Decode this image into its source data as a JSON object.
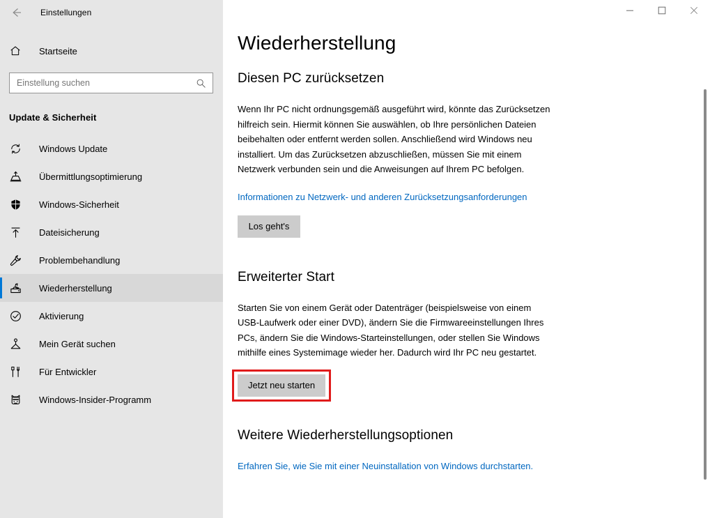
{
  "window": {
    "title": "Einstellungen",
    "back_icon": "back-arrow-icon",
    "minimize_label": "Minimieren",
    "maximize_label": "Maximieren",
    "close_label": "Schließen"
  },
  "sidebar": {
    "home": {
      "label": "Startseite",
      "icon": "home-icon"
    },
    "search": {
      "placeholder": "Einstellung suchen",
      "value": "",
      "icon": "search-icon"
    },
    "category": "Update & Sicherheit",
    "items": [
      {
        "label": "Windows Update",
        "icon": "refresh-icon",
        "selected": false
      },
      {
        "label": "Übermittlungsoptimierung",
        "icon": "delivery-optimization-icon",
        "selected": false
      },
      {
        "label": "Windows-Sicherheit",
        "icon": "shield-icon",
        "selected": false
      },
      {
        "label": "Dateisicherung",
        "icon": "backup-upload-icon",
        "selected": false
      },
      {
        "label": "Problembehandlung",
        "icon": "wrench-icon",
        "selected": false
      },
      {
        "label": "Wiederherstellung",
        "icon": "recovery-icon",
        "selected": true
      },
      {
        "label": "Aktivierung",
        "icon": "check-circle-icon",
        "selected": false
      },
      {
        "label": "Mein Gerät suchen",
        "icon": "find-device-icon",
        "selected": false
      },
      {
        "label": "Für Entwickler",
        "icon": "developer-tools-icon",
        "selected": false
      },
      {
        "label": "Windows-Insider-Programm",
        "icon": "insider-ninjacat-icon",
        "selected": false
      }
    ]
  },
  "main": {
    "page_title": "Wiederherstellung",
    "reset_section": {
      "heading": "Diesen PC zurücksetzen",
      "description": "Wenn Ihr PC nicht ordnungsgemäß ausgeführt wird, könnte das Zurücksetzen hilfreich sein. Hiermit können Sie auswählen, ob Ihre persönlichen Dateien beibehalten oder entfernt werden sollen. Anschließend wird Windows neu installiert. Um das Zurücksetzen abzuschließen, müssen Sie mit einem Netzwerk verbunden sein und die Anweisungen auf Ihrem PC befolgen.",
      "link": "Informationen zu Netzwerk- und anderen Zurücksetzungsanforderungen",
      "button": "Los geht's"
    },
    "advanced_startup_section": {
      "heading": "Erweiterter Start",
      "description": "Starten Sie von einem Gerät oder Datenträger (beispielsweise von einem USB-Laufwerk oder einer DVD), ändern Sie die Firmwareeinstellungen Ihres PCs, ändern Sie die Windows-Starteinstellungen, oder stellen Sie Windows mithilfe eines Systemimage wieder her. Dadurch wird Ihr PC neu gestartet.",
      "button": "Jetzt neu starten"
    },
    "more_options_section": {
      "heading": "Weitere Wiederherstellungsoptionen",
      "link": "Erfahren Sie, wie Sie mit einer Neuinstallation von Windows durchstarten."
    }
  },
  "annotation": {
    "target": "Jetzt neu starten",
    "color": "#e01b1b"
  },
  "colors": {
    "accent": "#0078d7",
    "link": "#0067c0",
    "sidebar_bg": "#e6e6e6",
    "button_bg": "#cccccc",
    "highlight": "#e01b1b"
  }
}
